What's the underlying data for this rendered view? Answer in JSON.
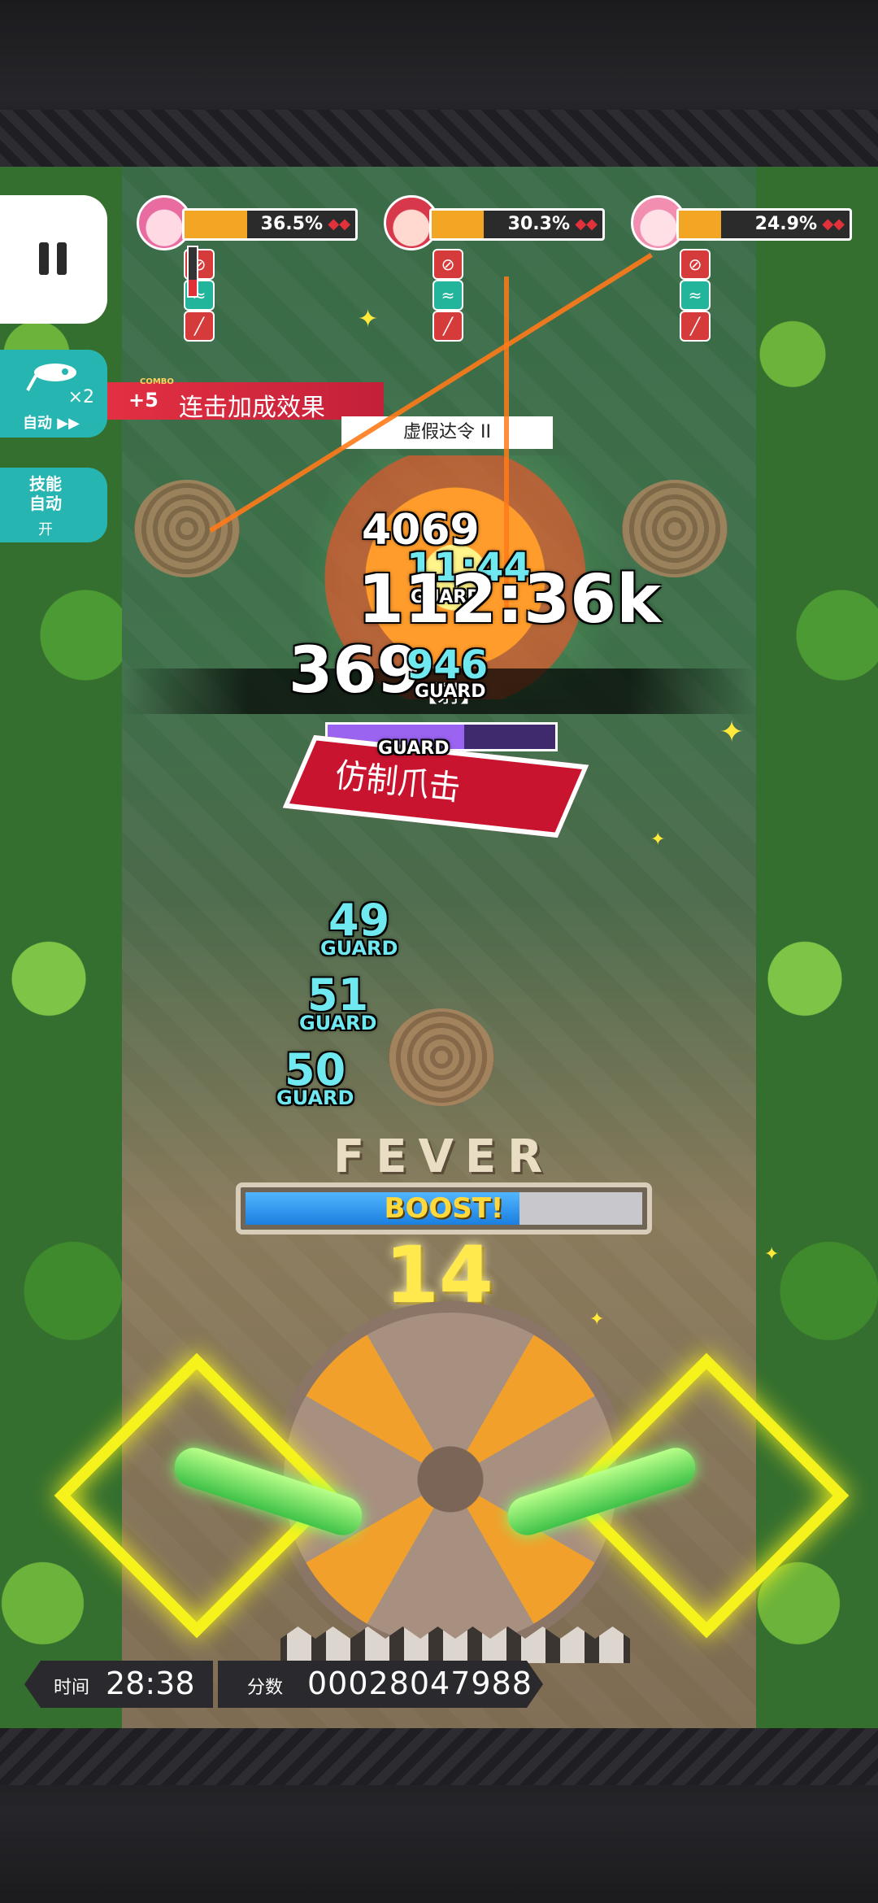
{
  "hud": {
    "pause_icon": "pause-icon",
    "auto_button": {
      "icon": "auto-play-icon",
      "multiplier": "×2",
      "label": "自动 ▶▶"
    },
    "skill_auto": {
      "label": "技能\n自动",
      "state": "开"
    }
  },
  "party": [
    {
      "hp_percent": 36.5,
      "hp_label": "36.5%",
      "buffs": [
        "attack-down-icon",
        "wing-buff-icon",
        "sword-down-icon"
      ],
      "gem": "◆◆"
    },
    {
      "hp_percent": 30.3,
      "hp_label": "30.3%",
      "buffs": [
        "attack-down-icon",
        "wing-buff-icon",
        "sword-down-icon"
      ],
      "gem": "◆◆"
    },
    {
      "hp_percent": 24.9,
      "hp_label": "24.9%",
      "buffs": [
        "attack-down-icon",
        "wing-buff-icon",
        "sword-down-icon"
      ],
      "gem": "◆◆"
    }
  ],
  "combo_bonus": {
    "tag": "COMBO",
    "plus": "+5",
    "label": "连击加成效果"
  },
  "boss": {
    "name": "虚假达令 II",
    "hp_fraction": 0.6,
    "skill_ribbon": "【射】",
    "attack_banner": "仿制爪击"
  },
  "damage_numbers": [
    {
      "text": "4069",
      "style": "white"
    },
    {
      "text": "11:44",
      "style": "cyan"
    },
    {
      "text": "GUARD",
      "style": "white"
    },
    {
      "text": "112:36k",
      "style": "white"
    },
    {
      "text": "369",
      "style": "white"
    },
    {
      "text": "946",
      "style": "cyan"
    },
    {
      "text": "GUARD",
      "style": "white"
    },
    {
      "text": "GUARD",
      "style": "white"
    },
    {
      "text": "49",
      "style": "cyan"
    },
    {
      "text": "GUARD",
      "style": "cyan"
    },
    {
      "text": "51",
      "style": "cyan"
    },
    {
      "text": "GUARD",
      "style": "cyan"
    },
    {
      "text": "50",
      "style": "cyan"
    },
    {
      "text": "GUARD",
      "style": "cyan"
    }
  ],
  "fever": {
    "label": "FEVER",
    "boost": "BOOST!",
    "fill_fraction": 0.69
  },
  "combo_count": "14",
  "status": {
    "time_label": "时间",
    "time": "28:38",
    "score_label": "分数",
    "score": "00028047988"
  }
}
